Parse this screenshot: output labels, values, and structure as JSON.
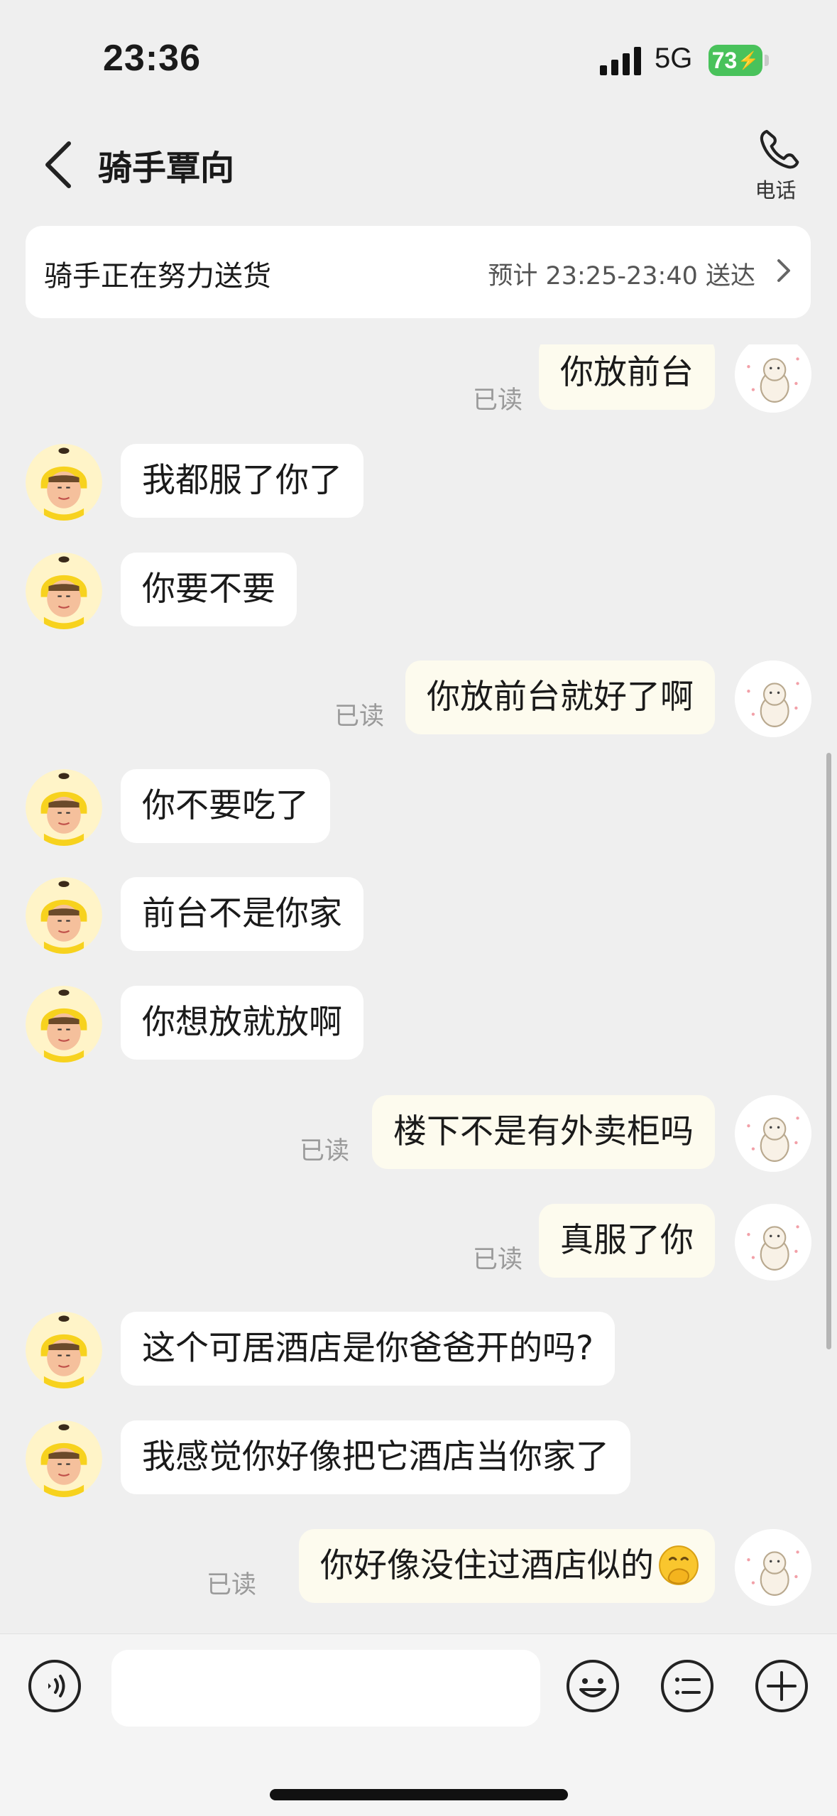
{
  "status_bar": {
    "time": "23:36",
    "network": "5G",
    "battery": "73"
  },
  "header": {
    "title": "骑手覃向",
    "phone_label": "电话"
  },
  "delivery": {
    "status": "骑手正在努力送货",
    "eta": "预计 23:25-23:40 送达"
  },
  "messages": [
    {
      "from": "me",
      "text": "你放前台",
      "read": "已读"
    },
    {
      "from": "rider",
      "text": "我都服了你了"
    },
    {
      "from": "rider",
      "text": "你要不要"
    },
    {
      "from": "me",
      "text": "你放前台就好了啊",
      "read": "已读"
    },
    {
      "from": "rider",
      "text": "你不要吃了"
    },
    {
      "from": "rider",
      "text": "前台不是你家"
    },
    {
      "from": "rider",
      "text": "你想放就放啊"
    },
    {
      "from": "me",
      "text": "楼下不是有外卖柜吗",
      "read": "已读"
    },
    {
      "from": "me",
      "text": "真服了你",
      "read": "已读"
    },
    {
      "from": "rider",
      "text": "这个可居酒店是你爸爸开的吗?"
    },
    {
      "from": "rider",
      "text": "我感觉你好像把它酒店当你家了"
    },
    {
      "from": "me",
      "text": "你好像没住过酒店似的",
      "emoji": "hand-over-mouth-emoji",
      "read": "已读"
    }
  ],
  "input_bar": {
    "icons": [
      "voice-icon",
      "emoji-icon",
      "quick-reply-icon",
      "plus-icon"
    ],
    "input_value": ""
  },
  "colors": {
    "background": "#efefef",
    "outgoing_bubble": "#fdfbee",
    "incoming_bubble": "#ffffff",
    "battery": "#49c25b",
    "rider_helmet": "#f7d21e"
  }
}
